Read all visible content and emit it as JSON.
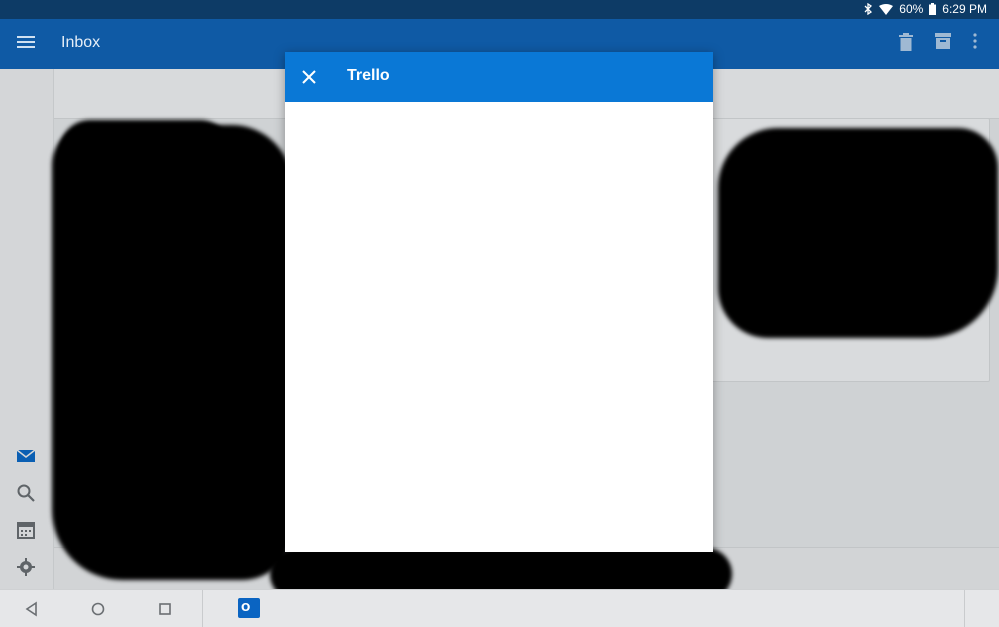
{
  "status_bar": {
    "battery_percent": "60%",
    "time": "6:29 PM",
    "icons": [
      "bluetooth-icon",
      "wifi-icon",
      "battery-icon"
    ]
  },
  "app_bar": {
    "title": "Inbox",
    "icons": [
      "menu-icon",
      "delete-icon",
      "archive-icon",
      "more-vert-icon"
    ]
  },
  "side_rail": {
    "icons": [
      "mail-icon",
      "search-icon",
      "calendar-icon",
      "settings-icon"
    ]
  },
  "dialog": {
    "title": "Trello",
    "close_icon": "close-icon"
  },
  "nav_bar": {
    "icons": [
      "back-icon",
      "home-icon",
      "recents-icon",
      "outlook-app-icon"
    ],
    "outlook_glyph": "O"
  },
  "colors": {
    "status_bar": "#0d3b66",
    "app_bar": "#0f5aa5",
    "dialog_header": "#0a78d6",
    "accent": "#0a64c2"
  }
}
